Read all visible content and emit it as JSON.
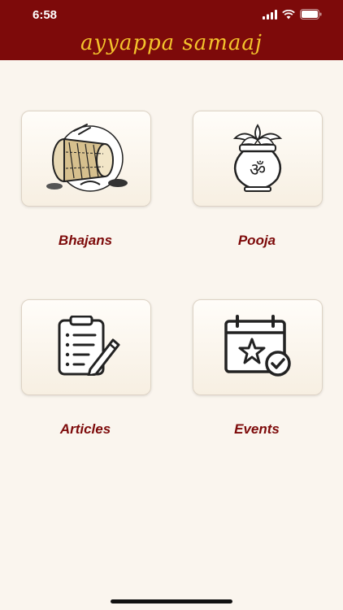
{
  "status_bar": {
    "time": "6:58",
    "icons": [
      "signal-icon",
      "wifi-icon",
      "battery-icon"
    ]
  },
  "header": {
    "title": "ayyappa samaaj",
    "background": "#7d0a0a",
    "title_color": "#f4c32c"
  },
  "menu": {
    "items": [
      {
        "label": "Bhajans",
        "icon": "drum-icon"
      },
      {
        "label": "Pooja",
        "icon": "kalash-om-icon"
      },
      {
        "label": "Articles",
        "icon": "clipboard-pen-icon"
      },
      {
        "label": "Events",
        "icon": "calendar-star-icon"
      }
    ],
    "label_color": "#7d0a0a"
  }
}
